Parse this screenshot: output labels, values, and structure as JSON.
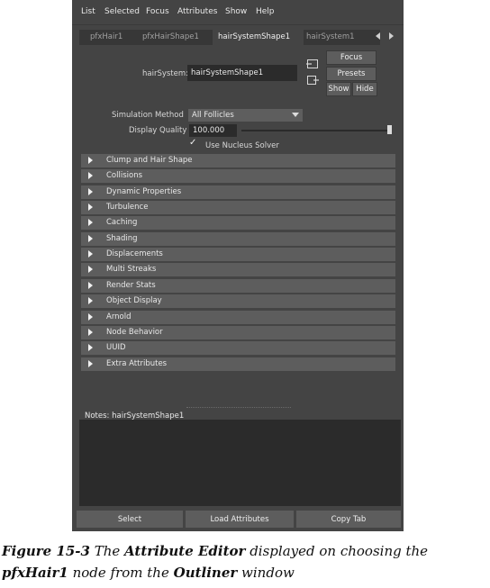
{
  "menu": [
    "List",
    "Selected",
    "Focus",
    "Attributes",
    "Show",
    "Help"
  ],
  "tabs": [
    {
      "label": "pfxHair1",
      "active": false
    },
    {
      "label": "pfxHairShape1",
      "active": false
    },
    {
      "label": "hairSystemShape1",
      "active": true
    },
    {
      "label": "hairSystem1",
      "active": false
    }
  ],
  "node": {
    "label": "hairSystem:",
    "value": "hairSystemShape1"
  },
  "buttons": {
    "focus": "Focus",
    "presets": "Presets",
    "show": "Show",
    "hide": "Hide"
  },
  "simulation": {
    "label": "Simulation Method",
    "value": "All Follicles"
  },
  "quality": {
    "label": "Display Quality",
    "value": "100.000",
    "slider_level": 1.0
  },
  "nucleus": {
    "label": "Use Nucleus Solver",
    "checked": true
  },
  "sections": [
    "Clump and Hair Shape",
    "Collisions",
    "Dynamic Properties",
    "Turbulence",
    "Caching",
    "Shading",
    "Displacements",
    "Multi Streaks",
    "Render Stats",
    "Object Display",
    "Arnold",
    "Node Behavior",
    "UUID",
    "Extra Attributes"
  ],
  "notes": {
    "label": "Notes:  hairSystemShape1",
    "value": ""
  },
  "bottom": {
    "select": "Select",
    "load": "Load Attributes",
    "copy": "Copy Tab"
  },
  "caption": {
    "fig": "Figure 15-3",
    "t1": " The ",
    "b1": "Attribute Editor",
    "t2": " displayed on choosing the ",
    "b2": "pfxHair1",
    "t3": " node from the ",
    "b3": "Outliner",
    "t4": " window"
  }
}
